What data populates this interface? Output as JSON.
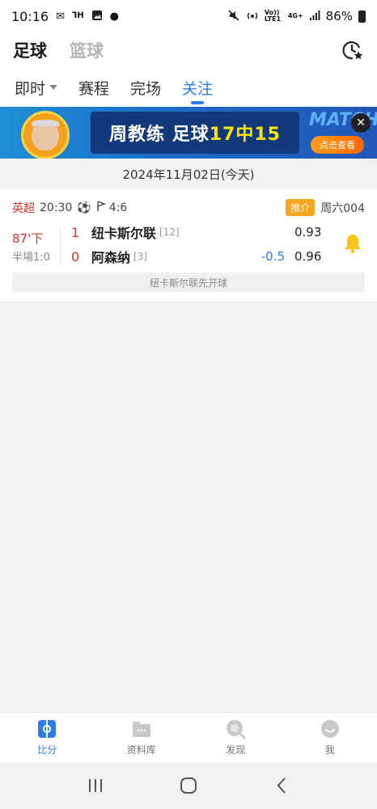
{
  "status_bar": {
    "time": "10:16",
    "network": "Vo)) LTE1",
    "signal": "4G+",
    "battery": "86%"
  },
  "top_nav": {
    "tabs": [
      {
        "label": "足球",
        "active": true
      },
      {
        "label": "篮球",
        "active": false
      }
    ]
  },
  "sub_tabs": [
    {
      "label": "即时",
      "active": false,
      "dropdown": true
    },
    {
      "label": "赛程",
      "active": false
    },
    {
      "label": "完场",
      "active": false
    },
    {
      "label": "关注",
      "active": true
    }
  ],
  "banner": {
    "text_prefix": "周教练 足球",
    "text_highlight": "17中15",
    "brand": "MATCH",
    "cta": "点击查看"
  },
  "date_header": "2024年11月02日(今天)",
  "match": {
    "league": "英超",
    "time": "20:30",
    "corners": "4:6",
    "tag": "推介",
    "match_no": "周六004",
    "minute": "87'下",
    "halftime": "半場1:0",
    "home": {
      "score": "1",
      "name": "纽卡斯尔联",
      "rank": "[12]",
      "odds": "0.93"
    },
    "away": {
      "score": "0",
      "name": "阿森纳",
      "rank": "[3]",
      "handicap": "-0.5",
      "odds": "0.96"
    },
    "note": "纽卡斯尔联先开球"
  },
  "bottom_nav": [
    {
      "label": "比分",
      "icon": "score-icon",
      "active": true
    },
    {
      "label": "资料库",
      "icon": "folder-icon",
      "active": false
    },
    {
      "label": "发现",
      "icon": "discover-icon",
      "active": false
    },
    {
      "label": "我",
      "icon": "profile-icon",
      "active": false
    }
  ],
  "colors": {
    "accent": "#2b7de9",
    "live_red": "#d0362e",
    "tag_orange": "#f5a623",
    "bell_yellow": "#f8c51c"
  }
}
